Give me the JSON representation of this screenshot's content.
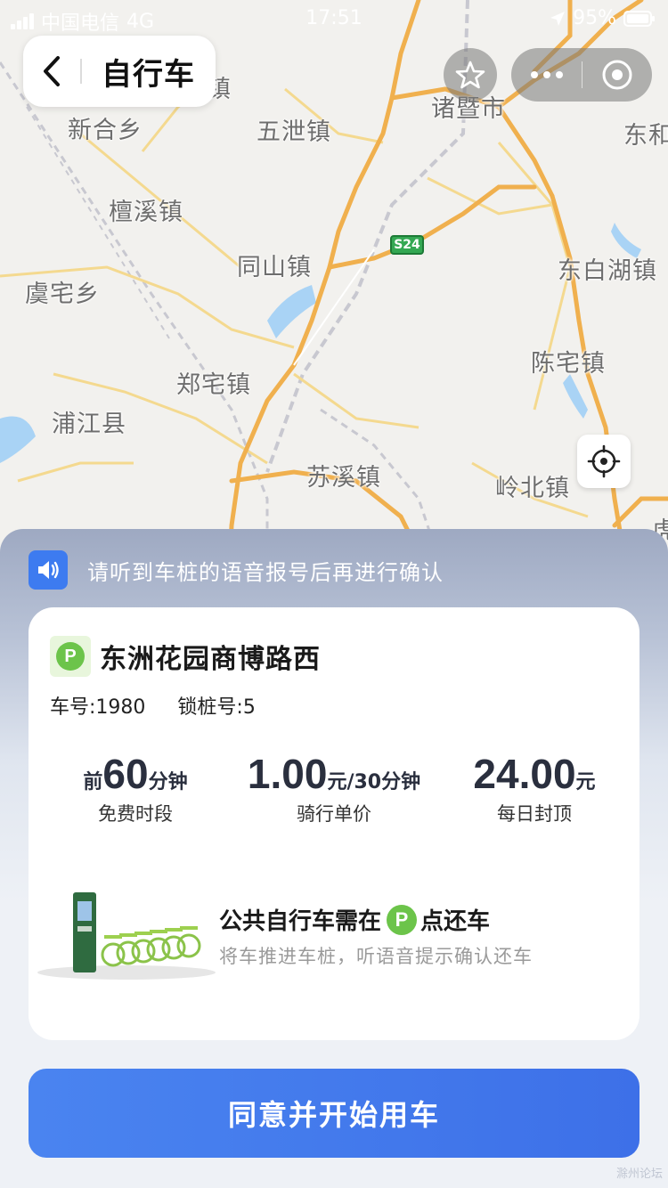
{
  "status_bar": {
    "carrier": "中国电信",
    "network": "4G",
    "time": "17:51",
    "battery": "95%"
  },
  "nav": {
    "title": "自行车"
  },
  "map": {
    "places": [
      {
        "name": "新合乡"
      },
      {
        "name": "五泄镇"
      },
      {
        "name": "诸暨市"
      },
      {
        "name": "东和"
      },
      {
        "name": "檀溪镇"
      },
      {
        "name": "同山镇"
      },
      {
        "name": "东白湖镇"
      },
      {
        "name": "虞宅乡"
      },
      {
        "name": "陈宅镇"
      },
      {
        "name": "郑宅镇"
      },
      {
        "name": "浦江县"
      },
      {
        "name": "苏溪镇"
      },
      {
        "name": "岭北镇"
      },
      {
        "name": "镇"
      },
      {
        "name": "虎"
      }
    ],
    "road_badge": "S24"
  },
  "notice": {
    "text": "请听到车桩的语音报号后再进行确认"
  },
  "station": {
    "badge": "P",
    "name": "东洲花园商博路西",
    "bike_no": "车号:1980",
    "dock_no": "锁桩号:5"
  },
  "stats": [
    {
      "prefix": "前",
      "value": "60",
      "unit": "分钟",
      "label": "免费时段"
    },
    {
      "prefix": "",
      "value": "1.00",
      "unit": "元/30分钟",
      "label": "骑行单价"
    },
    {
      "prefix": "",
      "value": "24.00",
      "unit": "元",
      "label": "每日封顶"
    }
  ],
  "return_info": {
    "title_before": "公共自行车需在",
    "title_badge": "P",
    "title_after": "点还车",
    "subtitle": "将车推进车桩，听语音提示确认还车"
  },
  "action": {
    "start_label": "同意并开始用车"
  },
  "colors": {
    "primary": "#3d74ec",
    "park_green": "#6cc44a"
  }
}
